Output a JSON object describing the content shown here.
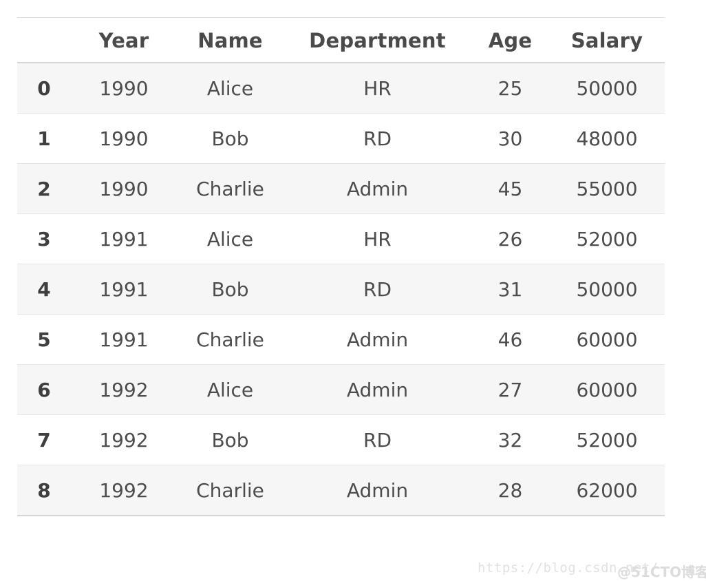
{
  "table": {
    "index_header": "",
    "columns": [
      "Year",
      "Name",
      "Department",
      "Age",
      "Salary"
    ],
    "rows": [
      {
        "index": "0",
        "Year": "1990",
        "Name": "Alice",
        "Department": "HR",
        "Age": "25",
        "Salary": "50000"
      },
      {
        "index": "1",
        "Year": "1990",
        "Name": "Bob",
        "Department": "RD",
        "Age": "30",
        "Salary": "48000"
      },
      {
        "index": "2",
        "Year": "1990",
        "Name": "Charlie",
        "Department": "Admin",
        "Age": "45",
        "Salary": "55000"
      },
      {
        "index": "3",
        "Year": "1991",
        "Name": "Alice",
        "Department": "HR",
        "Age": "26",
        "Salary": "52000"
      },
      {
        "index": "4",
        "Year": "1991",
        "Name": "Bob",
        "Department": "RD",
        "Age": "31",
        "Salary": "50000"
      },
      {
        "index": "5",
        "Year": "1991",
        "Name": "Charlie",
        "Department": "Admin",
        "Age": "46",
        "Salary": "60000"
      },
      {
        "index": "6",
        "Year": "1992",
        "Name": "Alice",
        "Department": "Admin",
        "Age": "27",
        "Salary": "60000"
      },
      {
        "index": "7",
        "Year": "1992",
        "Name": "Bob",
        "Department": "RD",
        "Age": "32",
        "Salary": "52000"
      },
      {
        "index": "8",
        "Year": "1992",
        "Name": "Charlie",
        "Department": "Admin",
        "Age": "28",
        "Salary": "62000"
      }
    ]
  },
  "watermark": {
    "url": "https://blog.csdn.net/",
    "brand": "@51CTO博客"
  },
  "colors": {
    "header_text": "#4a4a4a",
    "cell_text": "#4d4d4d",
    "stripe": "#f6f6f6",
    "rule": "#d6d6d6",
    "row_divider": "#e6e6e6",
    "watermark": "#e2e2e2",
    "background": "#ffffff"
  }
}
